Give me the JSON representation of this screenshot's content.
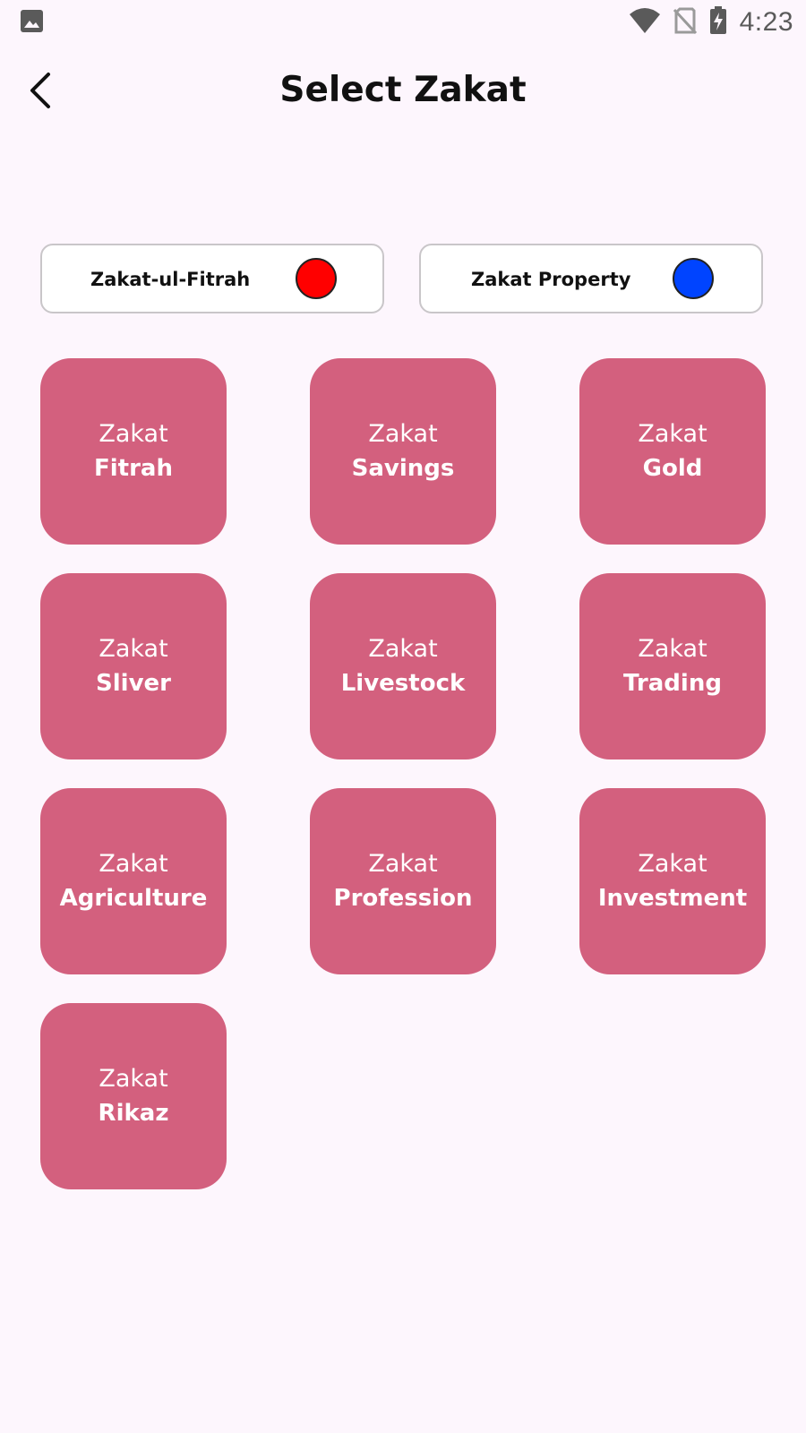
{
  "status_bar": {
    "time": "4:23",
    "left_icon": "image-icon",
    "right_icons": [
      "wifi-icon",
      "no-sim-icon",
      "battery-charging-icon"
    ]
  },
  "app_bar": {
    "title": "Select Zakat",
    "back_icon": "back-arrow-icon"
  },
  "toggles": [
    {
      "label": "Zakat-ul-Fitrah",
      "color": "#ff0000"
    },
    {
      "label": "Zakat Property",
      "color": "#0044ff"
    }
  ],
  "tiles": [
    {
      "prefix": "Zakat",
      "name": "Fitrah"
    },
    {
      "prefix": "Zakat",
      "name": "Savings"
    },
    {
      "prefix": "Zakat",
      "name": "Gold"
    },
    {
      "prefix": "Zakat",
      "name": "Sliver"
    },
    {
      "prefix": "Zakat",
      "name": "Livestock"
    },
    {
      "prefix": "Zakat",
      "name": "Trading"
    },
    {
      "prefix": "Zakat",
      "name": "Agriculture"
    },
    {
      "prefix": "Zakat",
      "name": "Profession"
    },
    {
      "prefix": "Zakat",
      "name": "Investment"
    },
    {
      "prefix": "Zakat",
      "name": "Rikaz"
    }
  ],
  "colors": {
    "background": "#fdf6fd",
    "tile": "#d3607e",
    "tile_text": "#ffffff"
  }
}
